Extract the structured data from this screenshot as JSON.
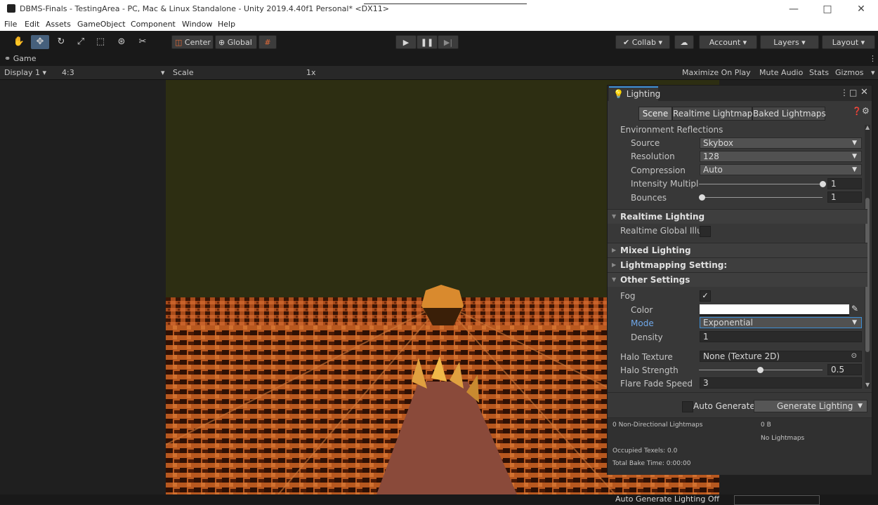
{
  "window": {
    "title": "DBMS-Finals - TestingArea - PC, Mac & Linux Standalone - Unity 2019.4.40f1 Personal* <DX11>",
    "minimize": "—",
    "maximize": "□",
    "close": "✕"
  },
  "menu": [
    "File",
    "Edit",
    "Assets",
    "GameObject",
    "Component",
    "Window",
    "Help"
  ],
  "toolbar": {
    "pivot_label": "Center",
    "space_label": "Global",
    "collab_label": "Collab",
    "account_label": "Account",
    "layers_label": "Layers",
    "layout_label": "Layout"
  },
  "game": {
    "tab_label": "Game",
    "display": "Display 1",
    "aspect": "4:3",
    "scale_label": "Scale",
    "scale_value": "1x",
    "maximize_on_play": "Maximize On Play",
    "mute_audio": "Mute Audio",
    "stats": "Stats",
    "gizmos": "Gizmos"
  },
  "lighting": {
    "tab_label": "Lighting",
    "subtabs": [
      "Scene",
      "Realtime Lightmaps",
      "Baked Lightmaps"
    ],
    "env_reflections": {
      "header": "Environment Reflections",
      "source_label": "Source",
      "source_value": "Skybox",
      "resolution_label": "Resolution",
      "resolution_value": "128",
      "compression_label": "Compression",
      "compression_value": "Auto",
      "intensity_label": "Intensity Multiplie",
      "intensity_value": "1",
      "bounces_label": "Bounces",
      "bounces_value": "1"
    },
    "realtime": {
      "header": "Realtime Lighting",
      "gi_label": "Realtime Global Illun"
    },
    "mixed": {
      "header": "Mixed Lighting"
    },
    "lightmapping": {
      "header": "Lightmapping Setting:"
    },
    "other": {
      "header": "Other Settings",
      "fog_label": "Fog",
      "fog_check": "✓",
      "color_label": "Color",
      "color_value": "#ffffff",
      "mode_label": "Mode",
      "mode_value": "Exponential",
      "density_label": "Density",
      "density_value": "1",
      "halo_texture_label": "Halo Texture",
      "halo_texture_value": "None (Texture 2D)",
      "halo_strength_label": "Halo Strength",
      "halo_strength_value": "0.5",
      "flare_fade_label": "Flare Fade Speed",
      "flare_fade_value": "3"
    },
    "auto_generate_label": "Auto Generate",
    "generate_button": "Generate Lighting",
    "stats": {
      "non_directional": "0 Non-Directional Lightmaps",
      "size": "0 B",
      "no_lightmaps": "No Lightmaps",
      "occupied": "Occupied Texels: 0.0",
      "bake_time": "Total Bake Time: 0:00:00"
    }
  },
  "status": {
    "text": "Auto Generate Lighting Off"
  },
  "colors": {
    "accent_blue": "#46607c",
    "field_highlight": "#3d8fd6",
    "scene_sky": "#2d2e12",
    "scene_ground": "#b0561c"
  }
}
